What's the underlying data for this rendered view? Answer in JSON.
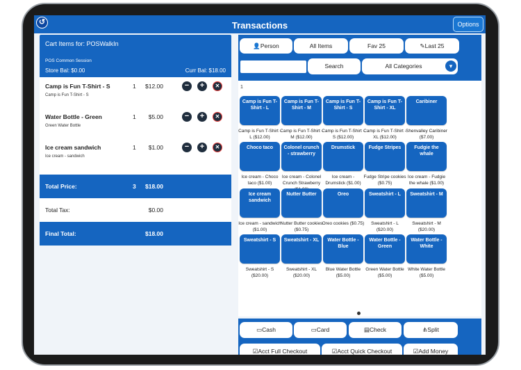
{
  "header": {
    "title": "Transactions",
    "options_label": "Options",
    "back_icon": "back-arrow-icon"
  },
  "cart": {
    "heading": "Cart Items for: POSWalkIn",
    "session": "POS Common Session",
    "store_bal": "Store Bal: $0.00",
    "curr_bal": "Curr Bal: $18.00",
    "items": [
      {
        "name": "Camp is Fun T-Shirt - S",
        "sub": "Camp is Fun T-Shirt - S",
        "qty": "1",
        "price": "$12.00"
      },
      {
        "name": "Water Bottle - Green",
        "sub": "Green Water Bottle",
        "qty": "1",
        "price": "$5.00"
      },
      {
        "name": "Ice cream sandwich",
        "sub": "Ice cream - sandwich",
        "qty": "1",
        "price": "$1.00"
      }
    ],
    "total_price": {
      "label": "Total Price:",
      "count": "3",
      "value": "$18.00"
    },
    "total_tax": {
      "label": "Total Tax:",
      "value": "$0.00"
    },
    "final_total": {
      "label": "Final Total:",
      "value": "$18.00"
    }
  },
  "filters": {
    "person": "Person",
    "all_items": "All Items",
    "fav": "Fav 25",
    "last": "Last 25",
    "search_placeholder": "",
    "search_button": "Search",
    "category": "All Categories"
  },
  "page_number": "1",
  "products": [
    {
      "label": "Camp is Fun T-Shirt - L",
      "caption": "Camp is Fun T-Shirt - L ($12.00)"
    },
    {
      "label": "Camp is Fun T-Shirt - M",
      "caption": "Camp is Fun T-Shirt - M ($12.00)"
    },
    {
      "label": "Camp is Fun T-Shirt - S",
      "caption": "Camp is Fun T-Shirt - S ($12.00)"
    },
    {
      "label": "Camp is Fun T-Shirt - XL",
      "caption": "Camp is Fun T-Shirt - XL ($12.00)"
    },
    {
      "label": "Caribiner",
      "caption": "Shenvalley Caribiner ($7.00)"
    },
    {
      "label": "Choco taco",
      "caption": "Ice cream - Choco taco ($1.00)"
    },
    {
      "label": "Colonel crunch - strawberry",
      "caption": "Ice cream - Colonel Crunch Strawberry ($1.00)"
    },
    {
      "label": "Drumstick",
      "caption": "Ice cream - Drumstick ($1.00)"
    },
    {
      "label": "Fudge Stripes",
      "caption": "Fudge Stripe cookies ($0.75)"
    },
    {
      "label": "Fudgie the whale",
      "caption": "Ice cream - Fudgie the whale ($1.00)"
    },
    {
      "label": "Ice cream sandwich",
      "caption": "Ice cream - sandwich ($1.00)"
    },
    {
      "label": "Nutter Butter",
      "caption": "Nutter Butter cookies ($0.75)"
    },
    {
      "label": "Oreo",
      "caption": "Oreo cookies ($0.75)"
    },
    {
      "label": "Sweatshirt - L",
      "caption": "Sweatshirt - L ($20.00)"
    },
    {
      "label": "Sweatshirt - M",
      "caption": "Sweatshirt - M ($20.00)"
    },
    {
      "label": "Sweatshirt - S",
      "caption": "Sweatshirt - S ($20.00)"
    },
    {
      "label": "Sweatshirt - XL",
      "caption": "Sweatshirt - XL ($20.00)"
    },
    {
      "label": "Water Bottle - Blue",
      "caption": "Blue Water Bottle ($5.00)"
    },
    {
      "label": "Water Bottle - Green",
      "caption": "Green Water Bottle ($5.00)"
    },
    {
      "label": "Water Bottle - White",
      "caption": "White Water Bottle ($5.00)"
    }
  ],
  "payments": {
    "cash": "Cash",
    "card": "Card",
    "check": "Check",
    "split": "Split",
    "acct_full": "Acct Full Checkout",
    "acct_quick": "Acct Quick Checkout",
    "add_money": "Add Money"
  },
  "colors": {
    "primary": "#1565c0",
    "background": "#f0f4f9",
    "remove": "#e53935"
  }
}
